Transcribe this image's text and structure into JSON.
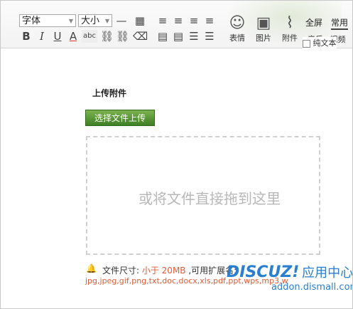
{
  "toolbar": {
    "font_family": "字体",
    "font_size": "大小",
    "emoji_label": "表情",
    "image_label": "图片",
    "attach_label": "附件",
    "fullscreen_label": "全屏",
    "common_label": "常用",
    "plaintext_label": "纯文本",
    "music_label": "音乐",
    "video_label": "视频"
  },
  "upload": {
    "title": "上传附件",
    "button_label": "选择文件上传",
    "drop_hint": "或将文件直接拖到这里",
    "size_label": "文件尺寸: ",
    "size_value": "小于 20MB",
    "ext_label": " ,可用扩展名: ",
    "extensions": "jpg,jpeg,gif,png,txt,doc,docx,xls,pdf,ppt,wps,mp3,w"
  },
  "watermark": {
    "brand": "DISCUZ!",
    "brand_cn": "应用中心",
    "url": "addon.dismall.com"
  },
  "icons": [
    "emoji-icon",
    "image-icon",
    "paperclip-icon",
    "bell-icon"
  ]
}
